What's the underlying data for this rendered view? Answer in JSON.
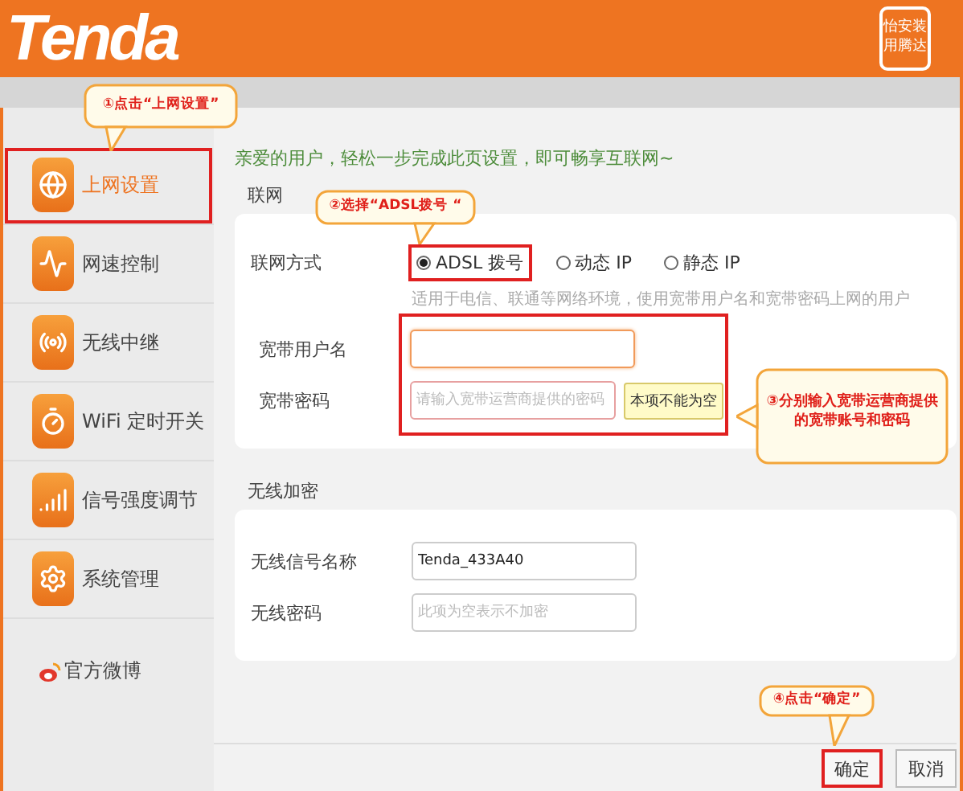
{
  "header": {
    "logo": "Tenda",
    "badge": [
      "怡安装",
      "用腾达"
    ]
  },
  "sidebar": {
    "items": [
      {
        "label": "上网设置",
        "selected": true,
        "highlighted": true
      },
      {
        "label": "网速控制",
        "selected": false,
        "highlighted": false
      },
      {
        "label": "无线中继",
        "selected": false,
        "highlighted": false
      },
      {
        "label": "WiFi 定时开关",
        "selected": false,
        "highlighted": false
      },
      {
        "label": "信号强度调节",
        "selected": false,
        "highlighted": false
      },
      {
        "label": "系统管理",
        "selected": false,
        "highlighted": false
      }
    ],
    "weibo": "官方微博"
  },
  "intro": "亲爱的用户，轻松一步完成此页设置，即可畅享互联网~",
  "network": {
    "title": "联网",
    "mode_label": "联网方式",
    "modes": [
      {
        "label": "ADSL 拨号",
        "selected": true,
        "highlighted": true
      },
      {
        "label": "动态 IP",
        "selected": false,
        "highlighted": false
      },
      {
        "label": "静态 IP",
        "selected": false,
        "highlighted": false
      }
    ],
    "hint": "适用于电信、联通等网络环境，使用宽带用户名和宽带密码上网的用户",
    "fields_highlighted": true,
    "fields": [
      {
        "label": "宽带用户名",
        "focused": true
      },
      {
        "label": "宽带密码",
        "placeholder": "请输入宽带运营商提供的密码",
        "focused": false,
        "error": "本项不能为空"
      }
    ]
  },
  "wireless": {
    "title": "无线加密",
    "fields": [
      {
        "label": "无线信号名称",
        "value": "Tenda_433A40"
      },
      {
        "label": "无线密码",
        "placeholder": "此项为空表示不加密"
      }
    ]
  },
  "buttons": [
    {
      "label": "确定",
      "highlighted": true
    },
    {
      "label": "取消",
      "highlighted": false
    }
  ],
  "callouts": [
    {
      "text": "①点击“上网设置”"
    },
    {
      "text": "②选择“ADSL拨号 “"
    },
    {
      "text": "③分别输入宽带运营商提供的宽带账号和密码"
    },
    {
      "text": "④点击“确定”"
    }
  ]
}
